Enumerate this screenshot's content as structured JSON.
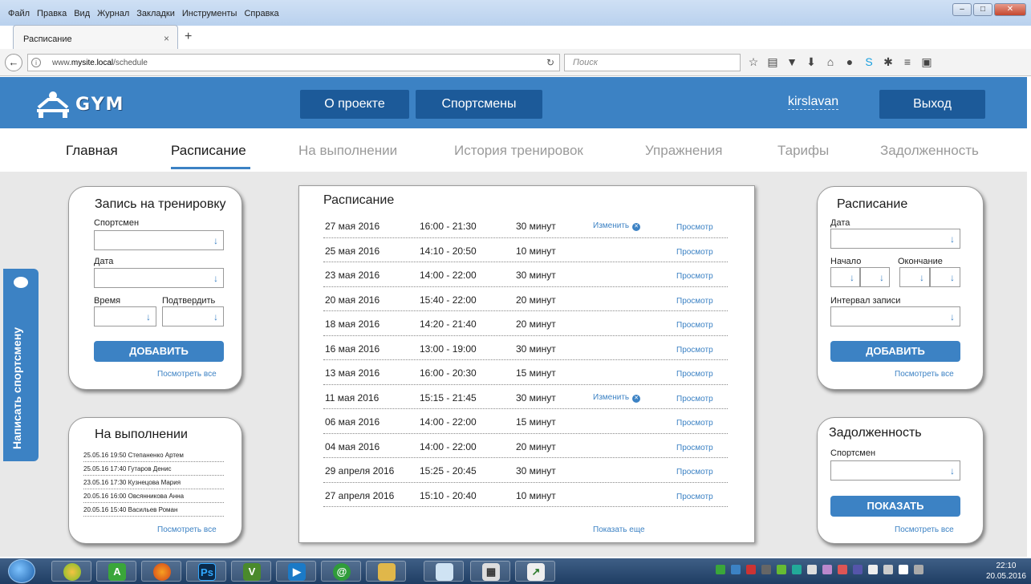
{
  "browser": {
    "menu": [
      "Файл",
      "Правка",
      "Вид",
      "Журнал",
      "Закладки",
      "Инструменты",
      "Справка"
    ],
    "tab_title": "Расписание",
    "url_prefix": "www.",
    "url_host": "mysite.local",
    "url_path": "/schedule",
    "search_placeholder": "Поиск"
  },
  "header": {
    "logo_text": "GYM",
    "about": "О проекте",
    "athletes": "Спортсмены",
    "username": "kirslavan",
    "logout": "Выход"
  },
  "nav": {
    "items": [
      "Главная",
      "Расписание",
      "На выполнении",
      "История тренировок",
      "Упражнения",
      "Тарифы",
      "Задолженность"
    ],
    "active": "Расписание"
  },
  "booking": {
    "title": "Запись на тренировку",
    "athlete_label": "Спортсмен",
    "date_label": "Дата",
    "time_label": "Время",
    "confirm_label": "Подтвердить",
    "add_button": "ДОБАВИТЬ",
    "view_all": "Посмотреть все"
  },
  "in_progress": {
    "title": "На выполнении",
    "rows": [
      "25.05.16 19:50 Степаненко Артем",
      "25.05.16 17:40 Гутаров Денис",
      "23.05.16 17:30 Кузнецова Мария",
      "20.05.16 16:00 Овсянникова Анна",
      "20.05.16 15:40 Васильев Роман"
    ],
    "view_all": "Посмотреть все"
  },
  "feedback_tab": "Написать спортсмену",
  "schedule": {
    "title": "Расписание",
    "rows": [
      {
        "date": "27 мая 2016",
        "time": "16:00 - 21:30",
        "duration": "30 минут",
        "edit": "Изменить",
        "view": "Просмотр"
      },
      {
        "date": "25 мая 2016",
        "time": "14:10 - 20:50",
        "duration": "10 минут",
        "edit": "",
        "view": "Просмотр"
      },
      {
        "date": "23 мая 2016",
        "time": "14:00 - 22:00",
        "duration": "30 минут",
        "edit": "",
        "view": "Просмотр"
      },
      {
        "date": "20 мая 2016",
        "time": "15:40 - 22:00",
        "duration": "20 минут",
        "edit": "",
        "view": "Просмотр"
      },
      {
        "date": "18 мая 2016",
        "time": "14:20 - 21:40",
        "duration": "20 минут",
        "edit": "",
        "view": "Просмотр"
      },
      {
        "date": "16 мая 2016",
        "time": "13:00 - 19:00",
        "duration": "30 минут",
        "edit": "",
        "view": "Просмотр"
      },
      {
        "date": "13 мая 2016",
        "time": "16:00 - 20:30",
        "duration": "15 минут",
        "edit": "",
        "view": "Просмотр"
      },
      {
        "date": "11 мая 2016",
        "time": "15:15 - 21:45",
        "duration": "30 минут",
        "edit": "Изменить",
        "view": "Просмотр"
      },
      {
        "date": "06 мая 2016",
        "time": "14:00 - 22:00",
        "duration": "15 минут",
        "edit": "",
        "view": "Просмотр"
      },
      {
        "date": "04 мая 2016",
        "time": "14:00 - 22:00",
        "duration": "20 минут",
        "edit": "",
        "view": "Просмотр"
      },
      {
        "date": "29 апреля 2016",
        "time": "15:25 - 20:45",
        "duration": "30 минут",
        "edit": "",
        "view": "Просмотр"
      },
      {
        "date": "27 апреля 2016",
        "time": "15:10 - 20:40",
        "duration": "10 минут",
        "edit": "",
        "view": "Просмотр"
      }
    ],
    "show_more": "Показать еще"
  },
  "schedule_form": {
    "title": "Расписание",
    "date_label": "Дата",
    "start_label": "Начало",
    "end_label": "Окончание",
    "interval_label": "Интервал записи",
    "add_button": "ДОБАВИТЬ",
    "view_all": "Посмотреть все"
  },
  "debt": {
    "title": "Задолженность",
    "athlete_label": "Спортсмен",
    "show_button": "ПОКАЗАТЬ",
    "view_all": "Посмотреть все"
  },
  "taskbar": {
    "time": "22:10",
    "date": "20.05.2016"
  },
  "colors": {
    "brand_blue": "#3c82c4",
    "header_button": "#1c5a99"
  }
}
